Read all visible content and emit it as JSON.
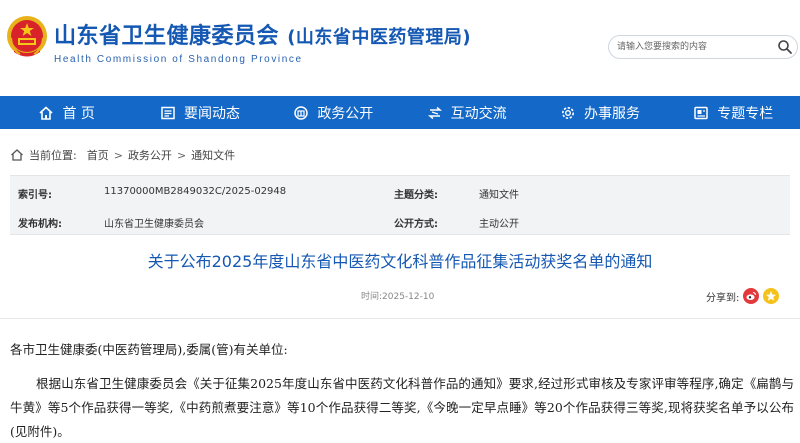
{
  "header": {
    "title": "山东省卫生健康委员会",
    "subtitle": "(山东省中医药管理局)",
    "title_en": "Health Commission of Shandong Province",
    "search_placeholder": "请输入您要搜索的内容",
    "brand_color": "#1558b3"
  },
  "nav": {
    "items": [
      {
        "label": "首  页",
        "icon": "home-icon"
      },
      {
        "label": "要闻动态",
        "icon": "news-icon"
      },
      {
        "label": "政务公开",
        "icon": "building-icon"
      },
      {
        "label": "互动交流",
        "icon": "exchange-icon"
      },
      {
        "label": "办事服务",
        "icon": "gear-icon"
      },
      {
        "label": "专题专栏",
        "icon": "column-icon"
      }
    ],
    "bg_color": "#1468c7"
  },
  "breadcrumb": {
    "label": "当前位置:",
    "items": [
      "首页",
      "政务公开",
      "通知文件"
    ]
  },
  "meta": {
    "index_label": "索引号:",
    "index_value": "11370000MB2849032C/2025-02948",
    "topic_label": "主题分类:",
    "topic_value": "通知文件",
    "publisher_label": "发布机构:",
    "publisher_value": "山东省卫生健康委员会",
    "disclosure_label": "公开方式:",
    "disclosure_value": "主动公开"
  },
  "article": {
    "title": "关于公布2025年度山东省中医药文化科普作品征集活动获奖名单的通知",
    "time": "时间:2025-12-10",
    "share_label": "分享到:",
    "salutation": "各市卫生健康委(中医药管理局),委属(管)有关单位:",
    "paragraph1": "根据山东省卫生健康委员会《关于征集2025年度山东省中医药文化科普作品的通知》要求,经过形式审核及专家评审等程序,确定《扁鹊与牛黄》等5个作品获得一等奖,《中药煎煮要注意》等10个作品获得二等奖,《今晚一定早点睡》等20个作品获得三等奖,现将获奖名单予以公布(见附件)。"
  }
}
